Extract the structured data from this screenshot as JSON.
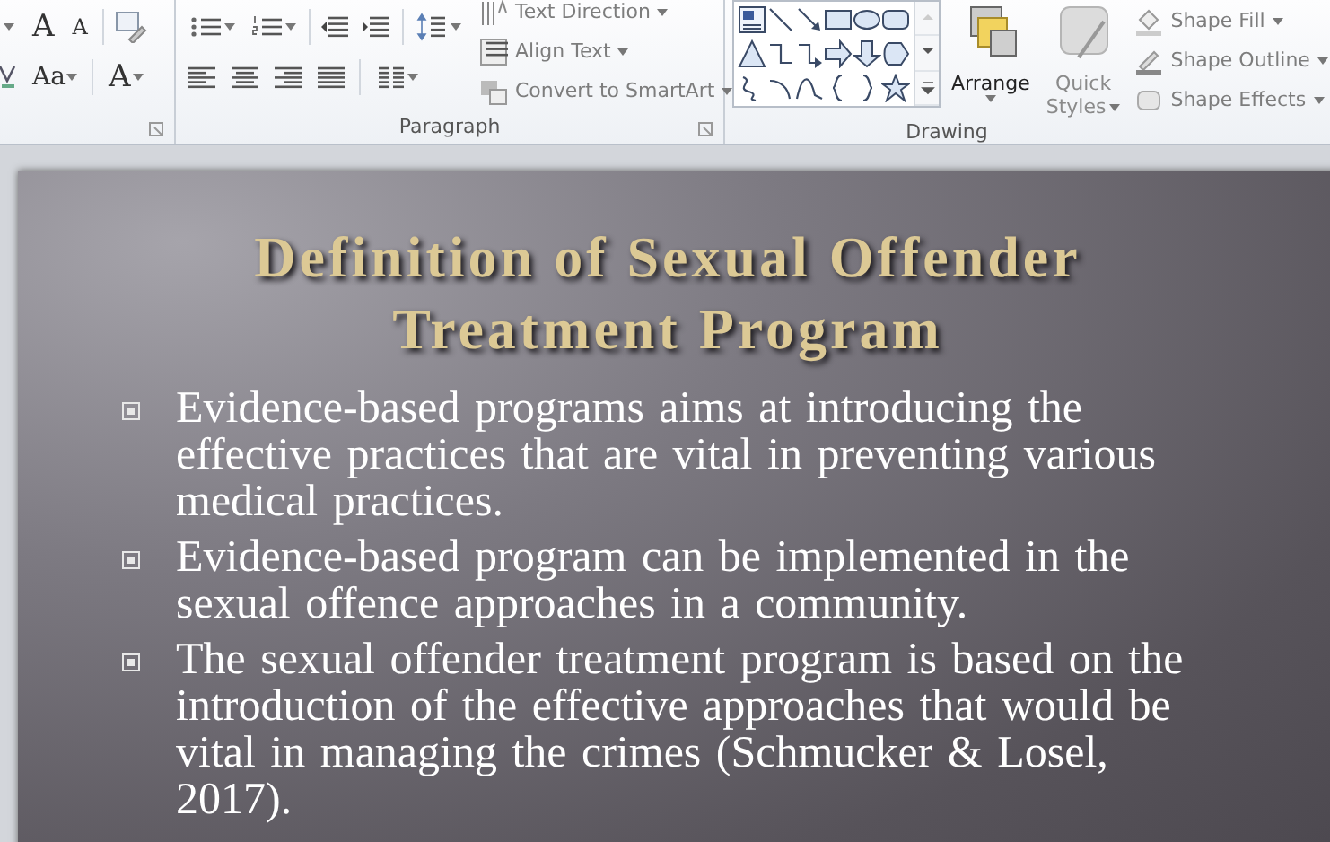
{
  "ribbon": {
    "font_group": {
      "grow_font": "A",
      "shrink_font": "A",
      "change_case": "Aa",
      "font_color": "A"
    },
    "paragraph_group": {
      "label": "Paragraph",
      "commands": [
        {
          "label": "Text Direction",
          "disabled": true
        },
        {
          "label": "Align Text",
          "disabled": true
        },
        {
          "label": "Convert to SmartArt",
          "disabled": true
        }
      ]
    },
    "drawing_group": {
      "label": "Drawing",
      "arrange": {
        "label": "Arrange",
        "disabled": false
      },
      "quick_styles": {
        "label_line_1": "Quick",
        "label_line_2": "Styles",
        "disabled": true
      },
      "commands": [
        {
          "label": "Shape Fill",
          "disabled": true
        },
        {
          "label": "Shape Outline",
          "disabled": true
        },
        {
          "label": "Shape Effects",
          "disabled": true
        }
      ]
    }
  },
  "slide": {
    "title": "Definition of Sexual Offender Treatment Program",
    "bullets": [
      "Evidence-based programs aims at introducing the effective practices that are vital in preventing various medical practices.",
      "Evidence-based program can be implemented in the sexual offence approaches in a community.",
      "The sexual offender treatment program is based on the introduction of the effective approaches that would be vital in managing the crimes (Schmucker & Losel, 2017)."
    ]
  }
}
